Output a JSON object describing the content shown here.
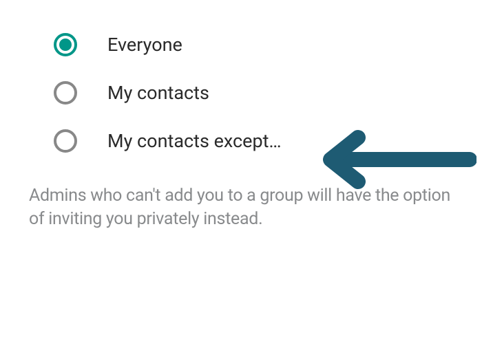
{
  "options": [
    {
      "label": "Everyone",
      "selected": true
    },
    {
      "label": "My contacts",
      "selected": false
    },
    {
      "label": "My contacts except…",
      "selected": false
    }
  ],
  "description": "Admins who can't add you to a group will have the option of inviting you privately instead.",
  "colors": {
    "accent": "#009688",
    "arrow": "#1e5b73"
  }
}
